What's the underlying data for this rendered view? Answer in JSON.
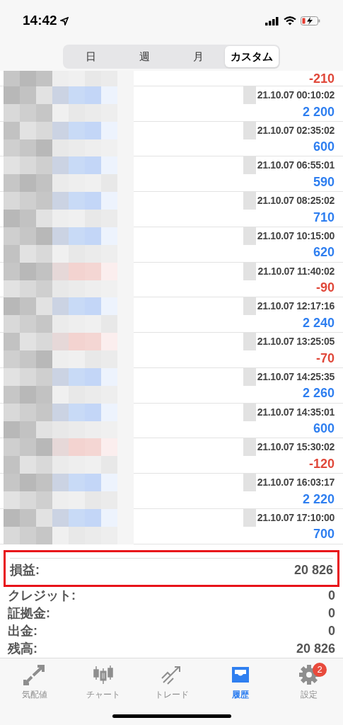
{
  "status_bar": {
    "time": "14:42"
  },
  "period_tabs": [
    {
      "label": "日",
      "selected": false
    },
    {
      "label": "週",
      "selected": false
    },
    {
      "label": "月",
      "selected": false
    },
    {
      "label": "カスタム",
      "selected": true
    }
  ],
  "deals": [
    {
      "profit": "-210",
      "kind": "loss"
    },
    {
      "time": "21.10.07 00:10:02",
      "profit": "2 200",
      "kind": "gain"
    },
    {
      "time": "21.10.07 02:35:02",
      "profit": "600",
      "kind": "gain"
    },
    {
      "time": "21.10.07 06:55:01",
      "profit": "590",
      "kind": "gain"
    },
    {
      "time": "21.10.07 08:25:02",
      "profit": "710",
      "kind": "gain"
    },
    {
      "time": "21.10.07 10:15:00",
      "profit": "620",
      "kind": "gain"
    },
    {
      "time": "21.10.07 11:40:02",
      "profit": "-90",
      "kind": "loss"
    },
    {
      "time": "21.10.07 12:17:16",
      "profit": "2 240",
      "kind": "gain"
    },
    {
      "time": "21.10.07 13:25:05",
      "profit": "-70",
      "kind": "loss"
    },
    {
      "time": "21.10.07 14:25:35",
      "profit": "2 260",
      "kind": "gain"
    },
    {
      "time": "21.10.07 14:35:01",
      "profit": "600",
      "kind": "gain"
    },
    {
      "time": "21.10.07 15:30:02",
      "profit": "-120",
      "kind": "loss"
    },
    {
      "time": "21.10.07 16:03:17",
      "profit": "2 220",
      "kind": "gain"
    },
    {
      "time": "21.10.07 17:10:00",
      "profit": "700",
      "kind": "gain"
    }
  ],
  "summary": [
    {
      "label": "損益:",
      "value": "20 826",
      "highlighted": true
    },
    {
      "label": "クレジット:",
      "value": "0",
      "highlighted": false
    },
    {
      "label": "証拠金:",
      "value": "0",
      "highlighted": false
    },
    {
      "label": "出金:",
      "value": "0",
      "highlighted": false
    },
    {
      "label": "残高:",
      "value": "20 826",
      "highlighted": false
    }
  ],
  "bottom_tabs": [
    {
      "label": "気配値",
      "selected": false
    },
    {
      "label": "チャート",
      "selected": false
    },
    {
      "label": "トレード",
      "selected": false
    },
    {
      "label": "履歴",
      "selected": true
    },
    {
      "label": "設定",
      "selected": false,
      "badge": "2"
    }
  ]
}
